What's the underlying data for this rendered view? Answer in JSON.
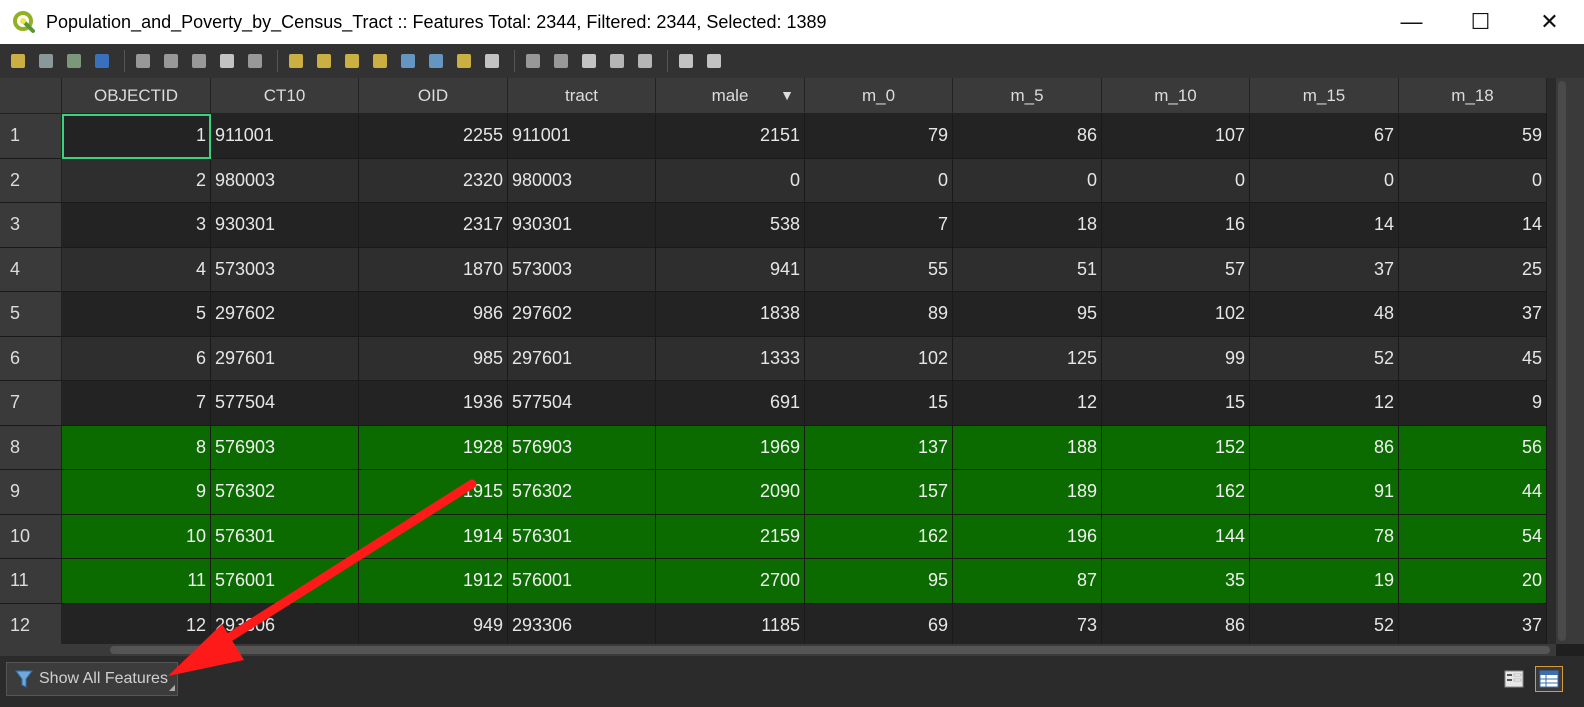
{
  "window": {
    "title": "Population_and_Poverty_by_Census_Tract :: Features Total: 2344, Filtered: 2344, Selected: 1389",
    "minimize_glyph": "—",
    "maximize_glyph": "☐",
    "close_glyph": "✕"
  },
  "toolbar": {
    "icons": [
      "edit-pencil-icon",
      "multi-edit-icon",
      "save-edits-icon",
      "reload-icon",
      "add-feature-icon",
      "delete-feature-icon",
      "cut-icon",
      "copy-icon",
      "paste-icon",
      "select-expression-icon",
      "select-all-icon",
      "invert-selection-icon",
      "deselect-all-icon",
      "filter-select-icon",
      "move-selection-top-icon",
      "pan-to-selected-icon",
      "zoom-to-selected-icon",
      "new-field-icon",
      "delete-field-icon",
      "field-calculator-icon",
      "conditional-format-icon",
      "organize-columns-icon",
      "dock-icon",
      "actions-icon"
    ]
  },
  "table": {
    "columns": [
      {
        "label": "OBJECTID",
        "width": 149
      },
      {
        "label": "CT10",
        "width": 148
      },
      {
        "label": "OID",
        "width": 149
      },
      {
        "label": "tract",
        "width": 148
      },
      {
        "label": "male",
        "width": 149,
        "sorted": "▼"
      },
      {
        "label": "m_0",
        "width": 148
      },
      {
        "label": "m_5",
        "width": 149
      },
      {
        "label": "m_10",
        "width": 148
      },
      {
        "label": "m_15",
        "width": 149
      },
      {
        "label": "m_18",
        "width": 148
      }
    ],
    "rows": [
      {
        "n": "1",
        "state": "dark",
        "cells": [
          "1",
          "911001",
          "2255",
          "911001",
          "2151",
          "79",
          "86",
          "107",
          "67",
          "59"
        ]
      },
      {
        "n": "2",
        "state": "light",
        "cells": [
          "2",
          "980003",
          "2320",
          "980003",
          "0",
          "0",
          "0",
          "0",
          "0",
          "0"
        ]
      },
      {
        "n": "3",
        "state": "dark",
        "cells": [
          "3",
          "930301",
          "2317",
          "930301",
          "538",
          "7",
          "18",
          "16",
          "14",
          "14"
        ]
      },
      {
        "n": "4",
        "state": "light",
        "cells": [
          "4",
          "573003",
          "1870",
          "573003",
          "941",
          "55",
          "51",
          "57",
          "37",
          "25"
        ]
      },
      {
        "n": "5",
        "state": "dark",
        "cells": [
          "5",
          "297602",
          "986",
          "297602",
          "1838",
          "89",
          "95",
          "102",
          "48",
          "37"
        ]
      },
      {
        "n": "6",
        "state": "light",
        "cells": [
          "6",
          "297601",
          "985",
          "297601",
          "1333",
          "102",
          "125",
          "99",
          "52",
          "45"
        ]
      },
      {
        "n": "7",
        "state": "dark",
        "cells": [
          "7",
          "577504",
          "1936",
          "577504",
          "691",
          "15",
          "12",
          "15",
          "12",
          "9"
        ]
      },
      {
        "n": "8",
        "state": "sel",
        "cells": [
          "8",
          "576903",
          "1928",
          "576903",
          "1969",
          "137",
          "188",
          "152",
          "86",
          "56"
        ]
      },
      {
        "n": "9",
        "state": "sel",
        "cells": [
          "9",
          "576302",
          "1915",
          "576302",
          "2090",
          "157",
          "189",
          "162",
          "91",
          "44"
        ]
      },
      {
        "n": "10",
        "state": "sel",
        "cells": [
          "10",
          "576301",
          "1914",
          "576301",
          "2159",
          "162",
          "196",
          "144",
          "78",
          "54"
        ]
      },
      {
        "n": "11",
        "state": "sel",
        "cells": [
          "11",
          "576001",
          "1912",
          "576001",
          "2700",
          "95",
          "87",
          "35",
          "19",
          "20"
        ]
      },
      {
        "n": "12",
        "state": "dark",
        "cells": [
          "12",
          "293306",
          "949",
          "293306",
          "1185",
          "69",
          "73",
          "86",
          "52",
          "37"
        ]
      }
    ],
    "text_columns": [
      1,
      3
    ]
  },
  "statusbar": {
    "filter_label": "Show All Features"
  },
  "colors": {
    "selected_row": "#0b6b00",
    "current_cell_outline": "#3ad27a",
    "annotation_arrow": "#ff1a1a"
  }
}
